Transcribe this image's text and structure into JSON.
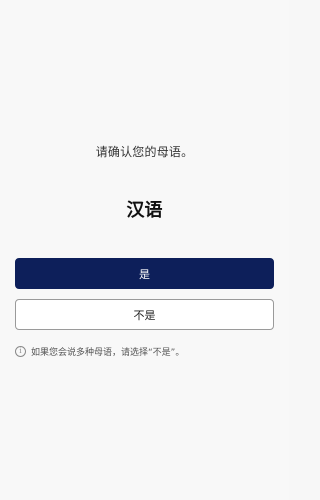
{
  "prompt": "请确认您的母语。",
  "language": "汉语",
  "buttons": {
    "yes_label": "是",
    "no_label": "不是"
  },
  "hint": {
    "icon": "info-icon",
    "text": "如果您会说多种母语，请选择“不是”。"
  },
  "colors": {
    "primary": "#0d1f5a",
    "background": "#f8f8f8"
  }
}
